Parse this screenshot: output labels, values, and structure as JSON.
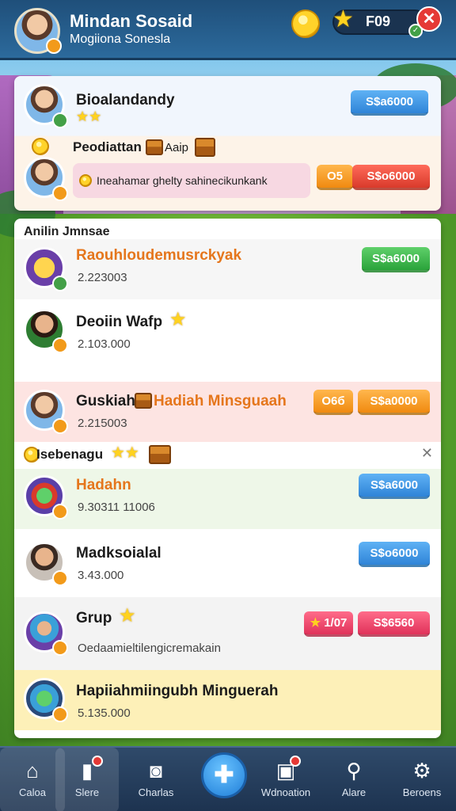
{
  "header": {
    "title": "Mindan Sosaid",
    "subtitle": "Mogiiona Sonesla",
    "counter": "F09"
  },
  "top_panel": {
    "player1": {
      "name": "Bioalandandy",
      "button": "S$a6000"
    },
    "player2": {
      "name": "Peodiattan",
      "reward_label": "Aaip",
      "message": "Ineahamar ghelty sahinecikunkank",
      "btn_small": "O5",
      "btn_big": "S$o6000"
    }
  },
  "list": {
    "section_title": "Anilin Jmnsae",
    "rows": [
      {
        "name": "Raouhloudemusrckyak",
        "amount": "2.223003",
        "button": "S$a6000"
      },
      {
        "name": "Deoiin Wafp",
        "amount": "2.103.000"
      },
      {
        "name": "Guskiah",
        "reward": "Hadiah Minsguaah",
        "amount": "2.215003",
        "btn_small": "O6б",
        "button": "S$a0000"
      },
      {
        "name": "Hadahn",
        "amount": "9.30311 11006",
        "button": "S$a6000"
      },
      {
        "name": "Madksoialal",
        "amount": "3.43.000",
        "button": "S$o6000"
      },
      {
        "name": "Grup",
        "amount": "Oedaamieltilengicremakain",
        "btn_small": "1/07",
        "button": "S$6560"
      },
      {
        "name": "Hapiiahmiingubh Minguerah",
        "amount": "5.135.000"
      }
    ],
    "divider_title": "Isebenagu"
  },
  "nav": {
    "items": [
      {
        "label": "Caloa",
        "icon": "home-icon"
      },
      {
        "label": "Slere",
        "icon": "chart-icon"
      },
      {
        "label": "Charlas",
        "icon": "camera-icon"
      },
      {
        "label": "Wdnoation",
        "icon": "card-icon"
      },
      {
        "label": "Alare",
        "icon": "search-icon"
      },
      {
        "label": "Beroens",
        "icon": "gear-icon"
      }
    ]
  }
}
